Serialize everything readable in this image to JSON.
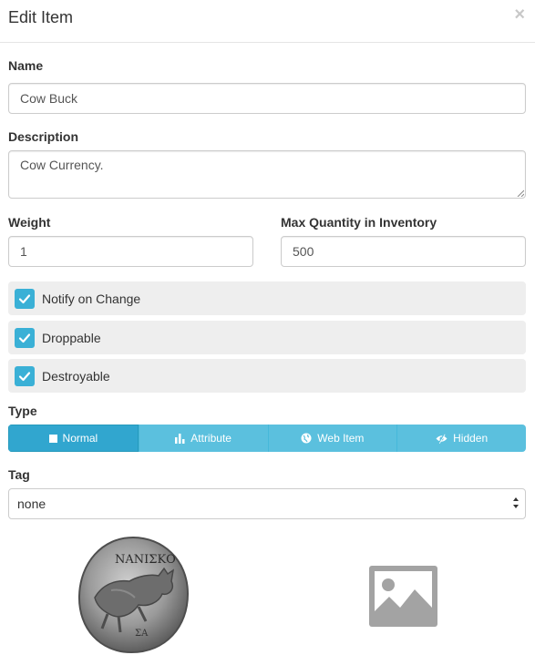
{
  "modal": {
    "title": "Edit Item",
    "close_label": "×"
  },
  "form": {
    "name_label": "Name",
    "name_value": "Cow Buck",
    "description_label": "Description",
    "description_value": "Cow Currency.",
    "weight_label": "Weight",
    "weight_value": "1",
    "max_qty_label": "Max Quantity in Inventory",
    "max_qty_value": "500"
  },
  "checkboxes": [
    {
      "label": "Notify on Change",
      "checked": true
    },
    {
      "label": "Droppable",
      "checked": true
    },
    {
      "label": "Destroyable",
      "checked": true
    }
  ],
  "type": {
    "label": "Type",
    "options": [
      {
        "label": "Normal",
        "icon": "square-icon",
        "active": true
      },
      {
        "label": "Attribute",
        "icon": "bar-chart-icon",
        "active": false
      },
      {
        "label": "Web Item",
        "icon": "globe-icon",
        "active": false
      },
      {
        "label": "Hidden",
        "icon": "eye-slash-icon",
        "active": false
      }
    ]
  },
  "tag": {
    "label": "Tag",
    "selected": "none"
  },
  "images": {
    "coin_inscription": "ΝΑΝΙΣΚΟ",
    "coin_bottom": "ΣΑ",
    "placeholder": "image-placeholder-icon"
  },
  "colors": {
    "accent": "#5bc0de",
    "active": "#31a6cf",
    "check": "#3ab0d6"
  }
}
